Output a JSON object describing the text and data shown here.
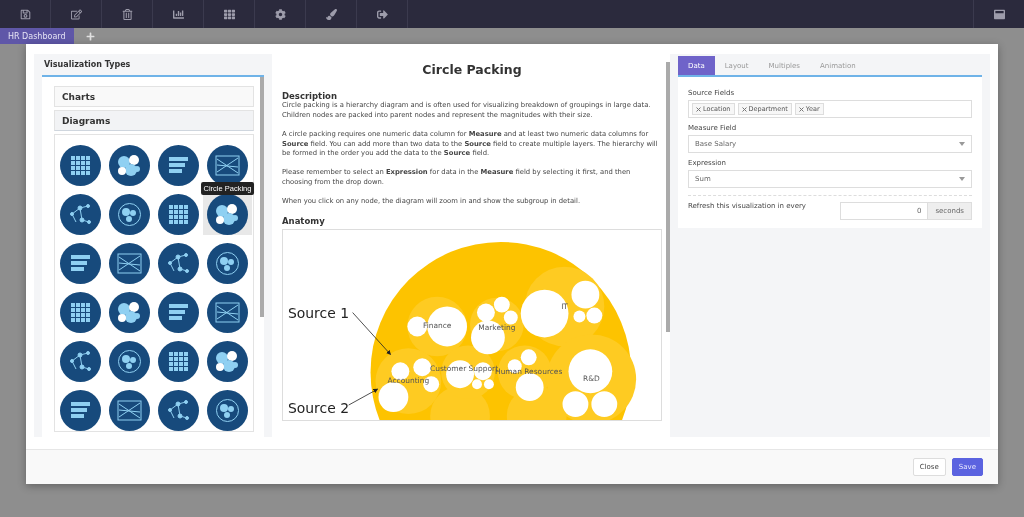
{
  "tabs": [
    {
      "label": "HR Dashboard",
      "selected": true
    }
  ],
  "visualization_types": {
    "title": "Visualization Types",
    "sections": [
      {
        "label": "Charts",
        "expanded": false
      },
      {
        "label": "Diagrams",
        "expanded": true
      }
    ],
    "tooltip": "Circle Packing",
    "items": [
      {
        "selected": false
      },
      {
        "selected": false
      },
      {
        "selected": false
      },
      {
        "selected": false
      },
      {
        "selected": false
      },
      {
        "selected": false
      },
      {
        "selected": false
      },
      {
        "selected": true
      },
      {
        "selected": false
      },
      {
        "selected": false
      },
      {
        "selected": false
      },
      {
        "selected": false
      },
      {
        "selected": false
      },
      {
        "selected": false
      },
      {
        "selected": false
      },
      {
        "selected": false
      },
      {
        "selected": false
      },
      {
        "selected": false
      },
      {
        "selected": false
      },
      {
        "selected": false
      },
      {
        "selected": false
      },
      {
        "selected": false
      },
      {
        "selected": false
      },
      {
        "selected": false
      }
    ]
  },
  "details": {
    "title": "Circle Packing",
    "description_heading": "Description",
    "paragraphs": [
      "Circle packing is a hierarchy diagram and is often used for visualizing breakdown of groupings in large data. Children nodes are packed into parent nodes and represent the magnitudes with their size.",
      "A circle packing requires one numeric data column for **Measure** and at least two numeric data columns for **Source** field. You can add more than two data to the **Source** field to create multiple layers. The hierarchy will be formed in the order you add the data to the **Source** field.",
      "Please remember to select an **Expression** for data in the **Measure** field by selecting it first, and then choosing from the drop down.",
      "When you click on any node, the diagram will zoom in and show the subgroup in detail."
    ],
    "anatomy_heading": "Anatomy",
    "anatomy": {
      "callouts": [
        "Source 1",
        "Source 2"
      ],
      "groups": [
        "Finance",
        "Marketing",
        "IT",
        "Accounting",
        "Customer Support",
        "Human Resources",
        "R&D"
      ]
    }
  },
  "settings": {
    "tabs": [
      {
        "label": "Data",
        "selected": true
      },
      {
        "label": "Layout",
        "selected": false
      },
      {
        "label": "Multiples",
        "selected": false
      },
      {
        "label": "Animation",
        "selected": false
      }
    ],
    "source_fields": {
      "label": "Source Fields",
      "tags": [
        "Location",
        "Department",
        "Year"
      ]
    },
    "measure_field": {
      "label": "Measure Field",
      "value": "Base Salary"
    },
    "expression": {
      "label": "Expression",
      "value": "Sum"
    },
    "refresh": {
      "label": "Refresh this visualization in every",
      "value": "0",
      "unit": "seconds"
    }
  },
  "footer": {
    "buttons": [
      {
        "label": "Close",
        "kind": "secondary"
      },
      {
        "label": "Save",
        "kind": "primary"
      }
    ]
  }
}
